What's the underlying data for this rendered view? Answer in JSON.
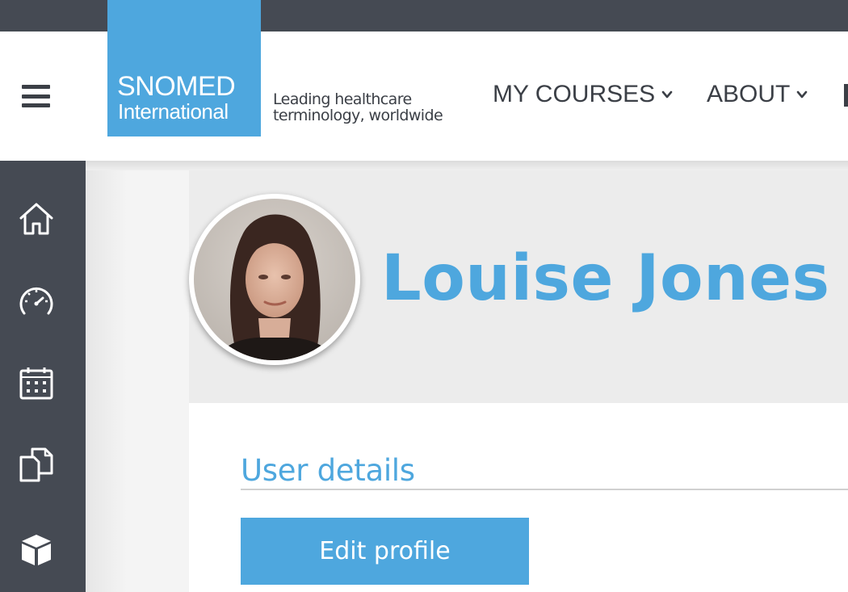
{
  "header": {
    "logo": {
      "line1": "SNOMED",
      "line2": "International"
    },
    "tagline_line1": "Leading healthcare",
    "tagline_line2": "terminology, worldwide",
    "nav": [
      {
        "label": "MY COURSES",
        "icon": "chevron-down-icon"
      },
      {
        "label": "ABOUT",
        "icon": "chevron-down-icon"
      }
    ],
    "menu_icon": "hamburger-menu-icon"
  },
  "sidebar": {
    "items": [
      {
        "icon": "home-icon"
      },
      {
        "icon": "dashboard-gauge-icon"
      },
      {
        "icon": "calendar-icon"
      },
      {
        "icon": "documents-icon"
      },
      {
        "icon": "cube-icon"
      }
    ]
  },
  "profile": {
    "name": "Louise Jones",
    "section_title": "User details",
    "edit_button_label": "Edit profile"
  },
  "colors": {
    "brand_blue": "#4ea7de",
    "dark_chrome": "#454a53",
    "text_dark": "#3b3f46"
  }
}
